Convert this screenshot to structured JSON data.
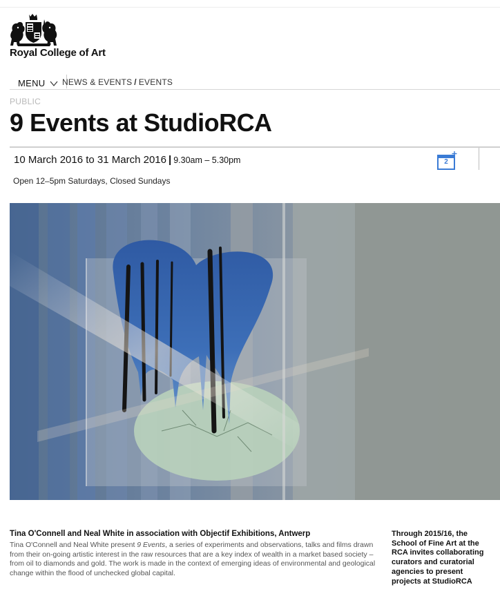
{
  "header": {
    "brand": "Royal College of Art",
    "logo_icon": "royal-crest-icon"
  },
  "nav": {
    "menu_label": "MENU",
    "menu_icon": "chevron-down-icon",
    "breadcrumbs": [
      "NEWS & EVENTS",
      "EVENTS"
    ],
    "separator": "/"
  },
  "event": {
    "category": "PUBLIC",
    "title": "9 Events at StudioRCA",
    "date_range": "10 March 2016 to 31 March 2016",
    "time": "9.30am – 5.30pm",
    "opening_hours": "Open 12–5pm Saturdays, Closed Sundays",
    "calendar_icon": "add-to-calendar-icon",
    "calendar_day": "2",
    "image_icon": "event-photo"
  },
  "description": {
    "lead": "Tina O'Connell and Neal White in association with Objectif Exhibitions, Antwerp",
    "body_before": "Tina O'Connell and Neal White present ",
    "body_em": "9 Events",
    "body_after": ", a series of experiments and observations, talks and films drawn from their on-going artistic interest in the raw resources that are a key index of wealth in a market based society – from oil to diamonds and gold. The work is made in the context of emerging ideas of environmental and geological change within the flood of unchecked global capital."
  },
  "sidebar": {
    "lines": [
      "Through 2015/16, the",
      "School of Fine Art at the",
      "RCA invites collaborating",
      "curators and curatorial",
      "agencies to present",
      "projects at StudioRCA"
    ]
  },
  "colors": {
    "accent_blue": "#3a7bd5",
    "muted_grey": "#b8b8b8"
  }
}
